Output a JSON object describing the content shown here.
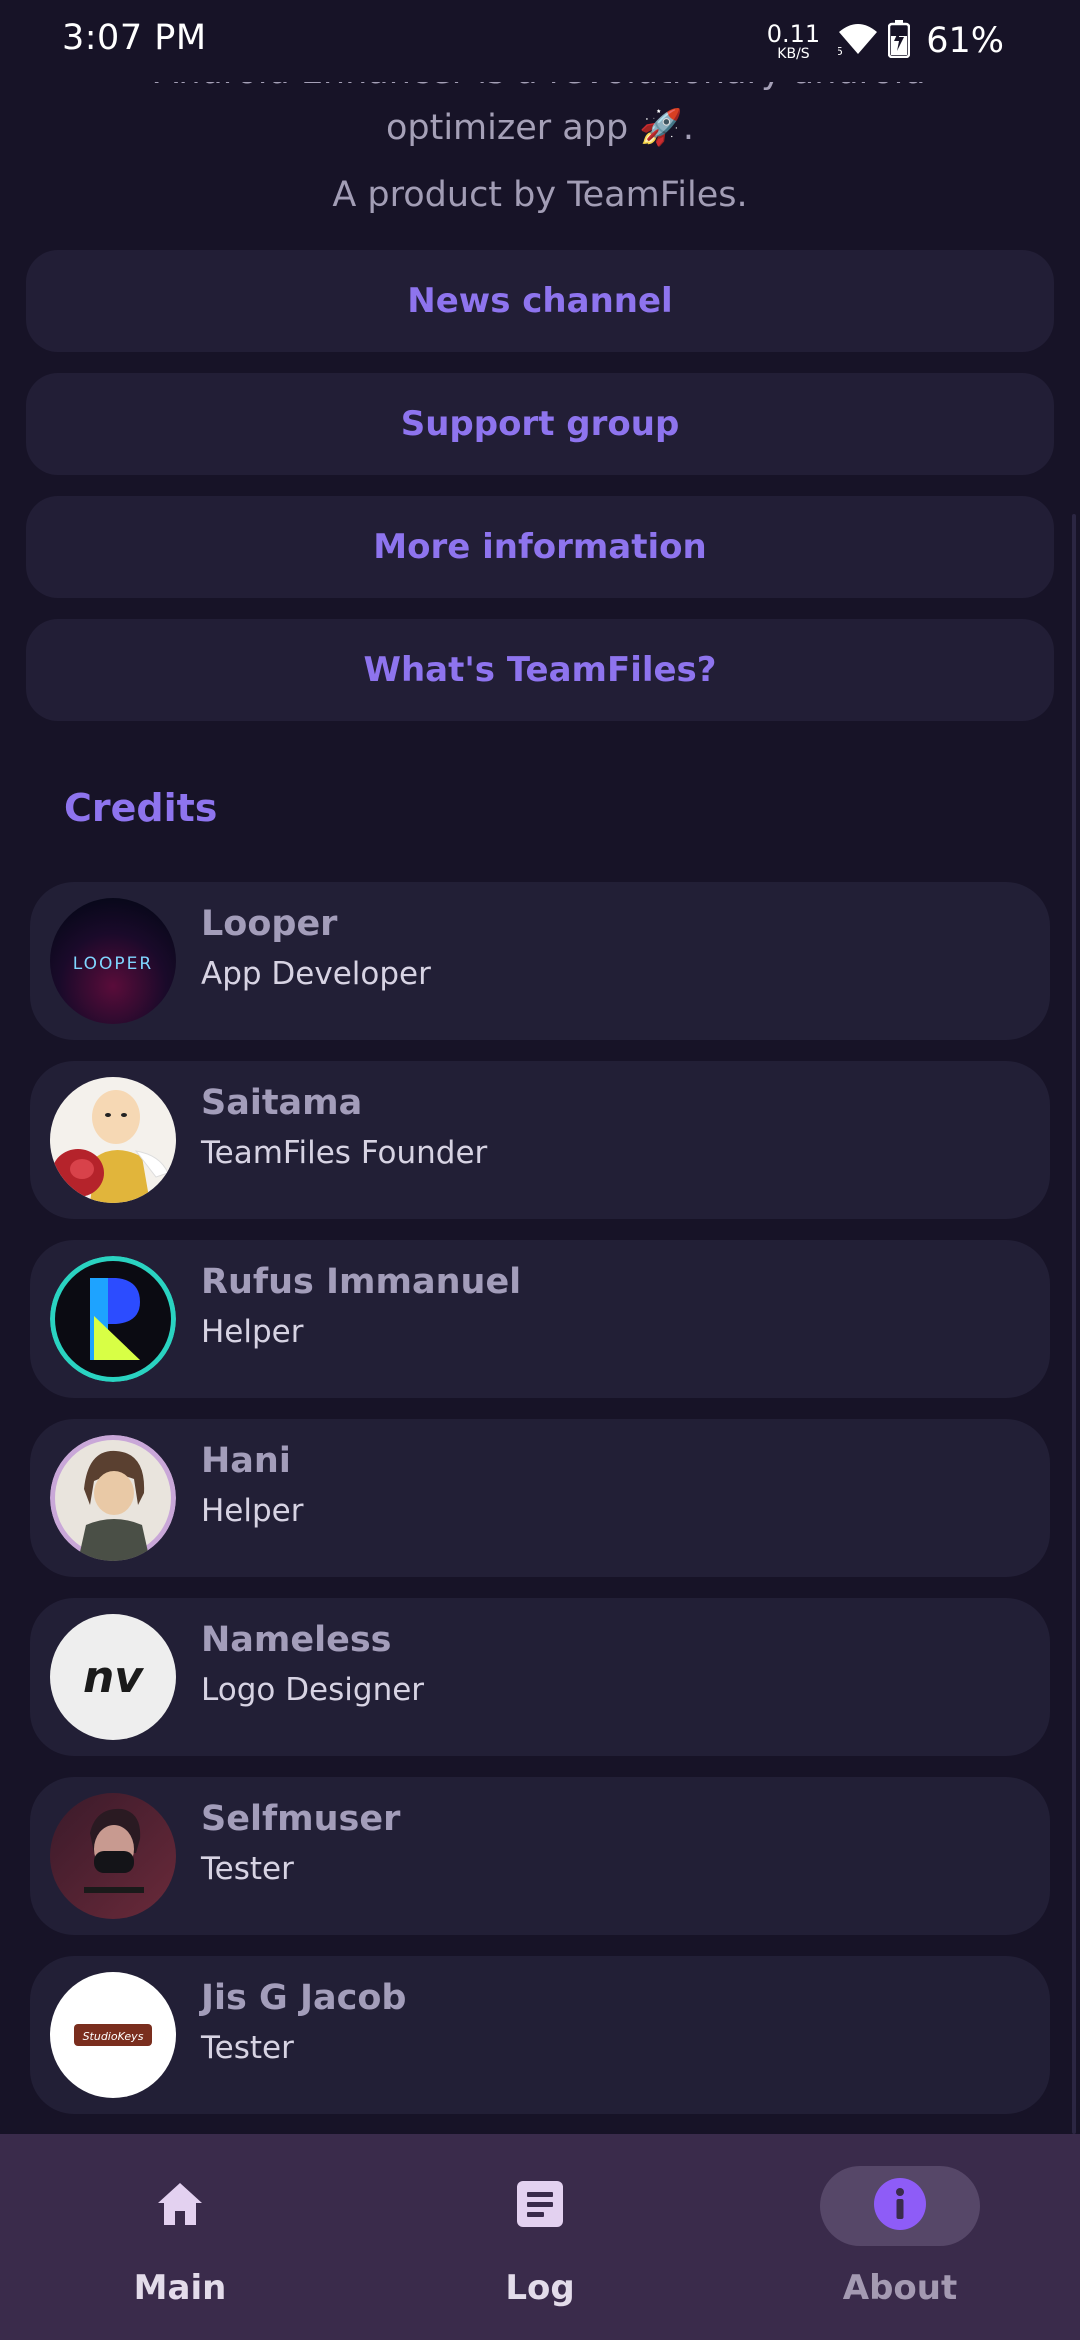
{
  "status_bar": {
    "time": "3:07 PM",
    "net_speed_value": "0.11",
    "net_speed_unit": "KB/S",
    "battery_percent": "61%",
    "icons": [
      "wifi-icon",
      "battery-charging-icon"
    ]
  },
  "intro": {
    "line1": "Android Enhancer is a revolutionary android",
    "line2": "optimizer app 🚀.",
    "line3": "A product by TeamFiles."
  },
  "links": [
    {
      "label": "News channel"
    },
    {
      "label": "Support group"
    },
    {
      "label": "More information"
    },
    {
      "label": "What's TeamFiles?"
    }
  ],
  "credits": {
    "title": "Credits",
    "items": [
      {
        "name": "Looper",
        "role": "App Developer",
        "avatar_text": "LOOPER"
      },
      {
        "name": "Saitama",
        "role": "TeamFiles Founder"
      },
      {
        "name": "Rufus Immanuel",
        "role": "Helper"
      },
      {
        "name": "Hani",
        "role": "Helper"
      },
      {
        "name": "Nameless",
        "role": "Logo Designer",
        "avatar_text": "nv"
      },
      {
        "name": "Selfmuser",
        "role": "Tester"
      },
      {
        "name": "Jis G Jacob",
        "role": "Tester",
        "avatar_text": "StudioKeys"
      }
    ]
  },
  "bottom_nav": {
    "items": [
      {
        "label": "Main",
        "icon": "home-icon",
        "active": false
      },
      {
        "label": "Log",
        "icon": "log-icon",
        "active": false
      },
      {
        "label": "About",
        "icon": "info-icon",
        "active": true
      }
    ]
  },
  "colors": {
    "background": "#171327",
    "accent": "#8e74ee",
    "card": "#221f36",
    "nav_bar": "#3a2b4b"
  }
}
